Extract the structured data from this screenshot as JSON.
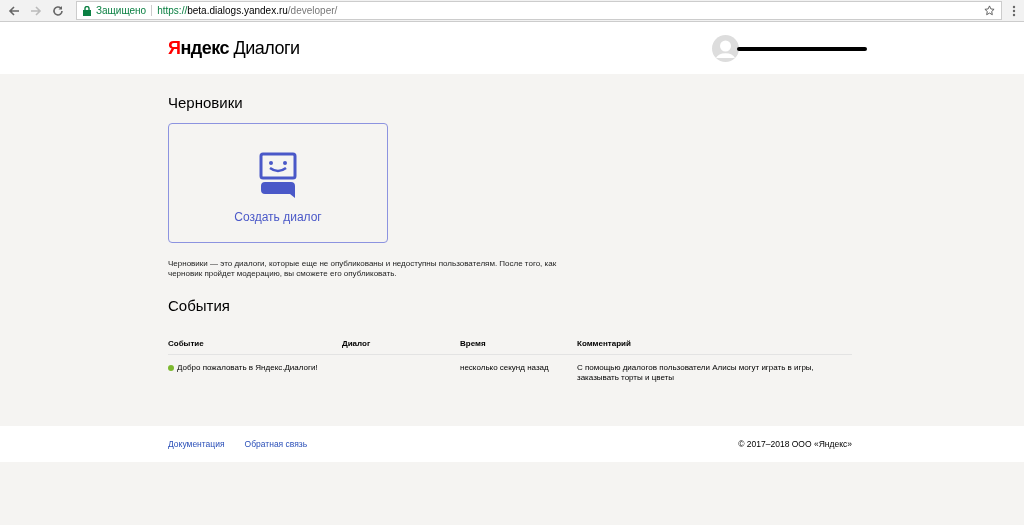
{
  "browser": {
    "secure_label": "Защищено",
    "url_scheme": "https://",
    "url_host": "beta.dialogs.yandex.ru",
    "url_path": "/developer/"
  },
  "header": {
    "logo": {
      "initial": "Я",
      "rest": "ндекс",
      "product": "Диалоги"
    }
  },
  "drafts": {
    "title": "Черновики",
    "create_label": "Создать диалог",
    "description": "Черновики — это диалоги, которые еще не опубликованы и недоступны пользователям. После того, как черновик пройдет модерацию, вы сможете его опубликовать."
  },
  "events": {
    "title": "События",
    "columns": [
      "Событие",
      "Диалог",
      "Время",
      "Комментарий"
    ],
    "rows": [
      {
        "color": "#7cb82f",
        "event": "Добро пожаловать в Яндекс.Диалоги!",
        "dialog": "",
        "time": "несколько секунд назад",
        "comment": "С помощью диалогов пользователи Алисы могут играть в игры, заказывать торты и цветы"
      }
    ]
  },
  "footer": {
    "links": [
      "Документация",
      "Обратная связь"
    ],
    "copyright": "© 2017–2018 ООО «Яндекс»"
  }
}
